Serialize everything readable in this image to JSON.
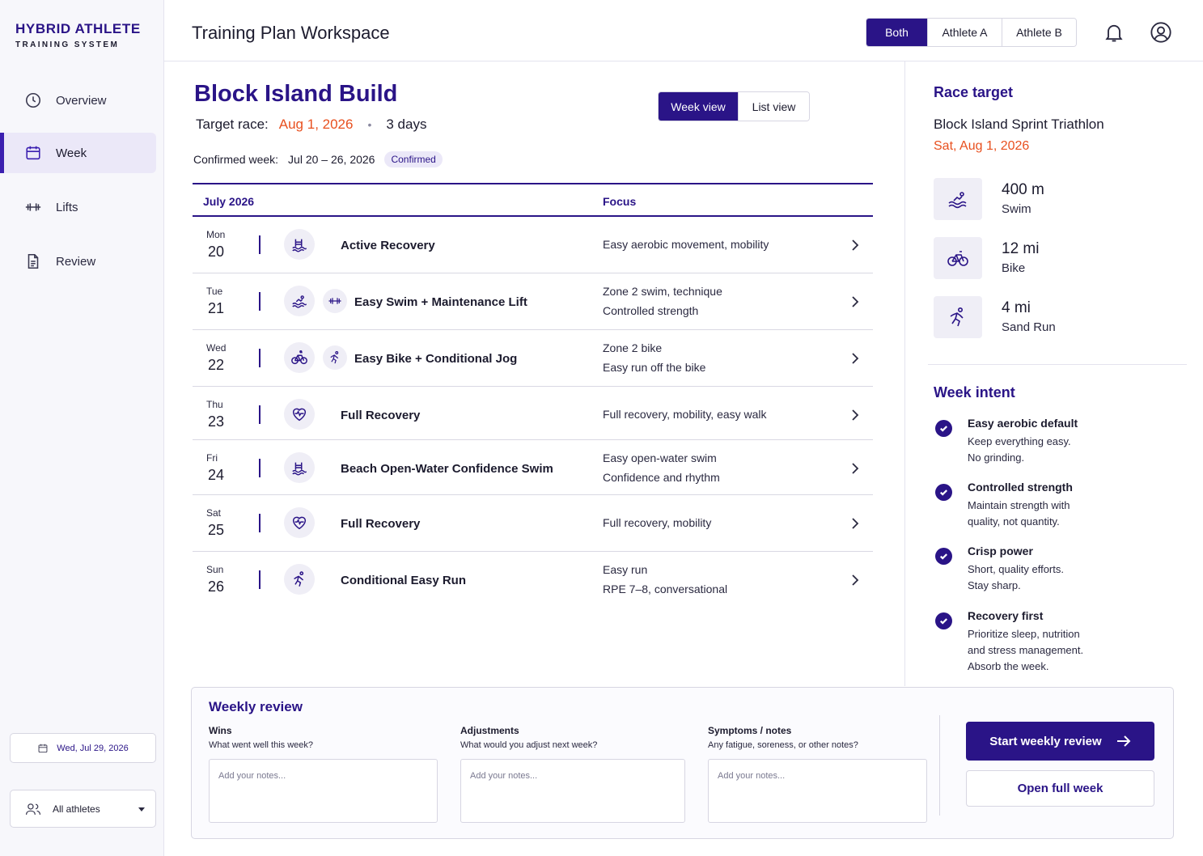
{
  "brand": {
    "title": "HYBRID ATHLETE",
    "subtitle": "TRAINING SYSTEM"
  },
  "nav": [
    {
      "label": "Overview",
      "icon": "clock-icon"
    },
    {
      "label": "Week",
      "icon": "calendar-icon",
      "active": true
    },
    {
      "label": "Lifts",
      "icon": "dumbbell-icon"
    },
    {
      "label": "Review",
      "icon": "document-icon"
    }
  ],
  "sidebar_footer": {
    "date": "Wed, Jul 29, 2026",
    "athlete_select": "All athletes"
  },
  "header": {
    "title": "Training Plan Workspace",
    "athlete_filter": [
      "Both",
      "Athlete A",
      "Athlete B"
    ],
    "athlete_filter_selected": "Both"
  },
  "plan": {
    "title": "Block Island Build",
    "target_label": "Target race:",
    "target_date": "Aug 1, 2026",
    "days_out": "3 days",
    "confirmed_label": "Confirmed week:",
    "confirmed_dates": "Jul 20 – 26, 2026",
    "confirmed_badge": "Confirmed",
    "view_toggle": [
      "Week view",
      "List view"
    ],
    "view_selected": "Week view"
  },
  "table": {
    "col_month": "July 2026",
    "col_focus": "Focus",
    "rows": [
      {
        "dow": "Mon",
        "day": "20",
        "icons": [
          "swim-pool-icon"
        ],
        "session": "Active Recovery",
        "focus": [
          "Easy aerobic movement, mobility"
        ]
      },
      {
        "dow": "Tue",
        "day": "21",
        "icons": [
          "swim-icon",
          "dumbbell-icon"
        ],
        "session": "Easy Swim + Maintenance Lift",
        "focus": [
          "Zone 2 swim, technique",
          "Controlled strength"
        ]
      },
      {
        "dow": "Wed",
        "day": "22",
        "icons": [
          "bike-icon",
          "run-icon"
        ],
        "session": "Easy Bike + Conditional Jog",
        "focus": [
          "Zone 2 bike",
          "Easy run off the bike"
        ]
      },
      {
        "dow": "Thu",
        "day": "23",
        "icons": [
          "heart-icon"
        ],
        "session": "Full Recovery",
        "focus": [
          "Full recovery, mobility, easy walk"
        ]
      },
      {
        "dow": "Fri",
        "day": "24",
        "icons": [
          "swim-pool-icon"
        ],
        "session": "Beach Open-Water Confidence Swim",
        "focus": [
          "Easy open-water swim",
          "Confidence and rhythm"
        ]
      },
      {
        "dow": "Sat",
        "day": "25",
        "icons": [
          "heart-icon"
        ],
        "session": "Full Recovery",
        "focus": [
          "Full recovery, mobility"
        ]
      },
      {
        "dow": "Sun",
        "day": "26",
        "icons": [
          "run-icon"
        ],
        "session": "Conditional Easy Run",
        "focus": [
          "Easy run",
          "RPE 7–8, conversational"
        ]
      }
    ]
  },
  "race": {
    "heading": "Race target",
    "name": "Block Island Sprint Triathlon",
    "date": "Sat, Aug 1, 2026",
    "stats": [
      {
        "value": "400 m",
        "label": "Swim",
        "icon": "swim-icon"
      },
      {
        "value": "12 mi",
        "label": "Bike",
        "icon": "bike-icon"
      },
      {
        "value": "4 mi",
        "label": "Sand Run",
        "icon": "run-icon"
      }
    ]
  },
  "intent": {
    "heading": "Week intent",
    "items": [
      {
        "title": "Easy aerobic default",
        "desc": "Keep everything easy.\nNo grinding."
      },
      {
        "title": "Controlled strength",
        "desc": "Maintain strength with\nquality, not quantity."
      },
      {
        "title": "Crisp power",
        "desc": "Short, quality efforts.\nStay sharp."
      },
      {
        "title": "Recovery first",
        "desc": "Prioritize sleep, nutrition\nand stress management.\nAbsorb the week."
      }
    ]
  },
  "review": {
    "title": "Weekly review",
    "fields": [
      {
        "heading": "Wins",
        "question": "What went well this week?",
        "placeholder": "Add your notes..."
      },
      {
        "heading": "Adjustments",
        "question": "What would you adjust next week?",
        "placeholder": "Add your notes..."
      },
      {
        "heading": "Symptoms / notes",
        "question": "Any fatigue, soreness, or other notes?",
        "placeholder": "Add your notes..."
      }
    ],
    "primary_button": "Start weekly review",
    "secondary_button": "Open full week"
  },
  "colors": {
    "accent": "#2a1487",
    "highlight": "#e8501f",
    "active_nav_bg": "#ebe8f8"
  }
}
